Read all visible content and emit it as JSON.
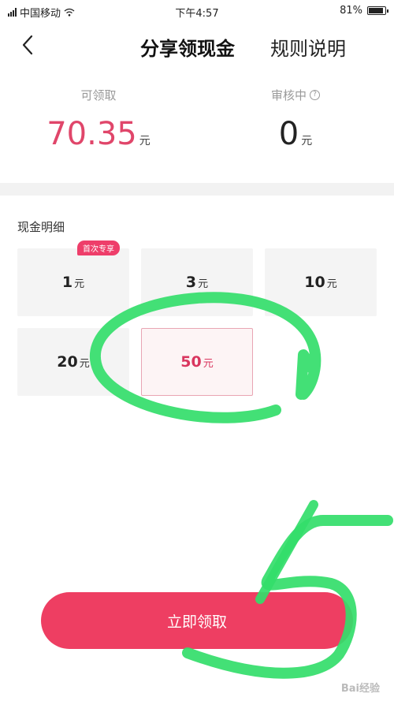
{
  "status_bar": {
    "carrier": "中国移动",
    "time": "下午4:57",
    "battery": "81%"
  },
  "header": {
    "title": "分享领现金",
    "rules_link": "规则说明"
  },
  "summary": {
    "claimable_label": "可领取",
    "claimable_amount": "70.35",
    "claimable_unit": "元",
    "review_label": "审核中",
    "review_amount": "0",
    "review_unit": "元"
  },
  "cash_detail": {
    "title": "现金明细",
    "badge": "首次专享",
    "options": [
      {
        "amount": "1",
        "unit": "元"
      },
      {
        "amount": "3",
        "unit": "元"
      },
      {
        "amount": "10",
        "unit": "元"
      },
      {
        "amount": "20",
        "unit": "元"
      },
      {
        "amount": "50",
        "unit": "元"
      }
    ]
  },
  "actions": {
    "claim_button": "立即领取"
  },
  "watermark": "Bai经验"
}
